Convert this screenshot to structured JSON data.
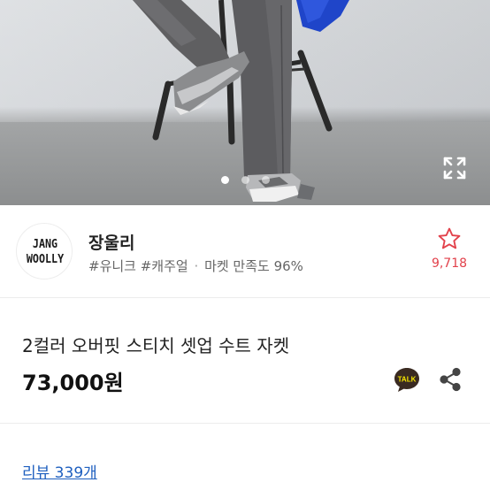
{
  "gallery": {
    "image_count": 3,
    "active_index": 0,
    "expand_icon": "expand-icon"
  },
  "seller": {
    "name": "장울리",
    "avatar_logo_text": [
      "JANG",
      "WOOLLY"
    ],
    "tags": "#유니크 #캐주얼",
    "separator": "·",
    "satisfaction": "마켓 만족도 96%",
    "favorite_icon": "star-outline-icon",
    "favorite_count": "9,718"
  },
  "product": {
    "title": "2컬러 오버핏 스티치 셋업 수트 자켓",
    "price": "73,000원",
    "talk_label": "TALK",
    "share_icon": "share-icon"
  },
  "reviews": {
    "link_text": "리뷰 339개"
  },
  "colors": {
    "accent_red": "#e2414b",
    "link_blue": "#1e5fbf",
    "kakao_yellow": "#2a1f1f",
    "text_dark": "#222222"
  }
}
